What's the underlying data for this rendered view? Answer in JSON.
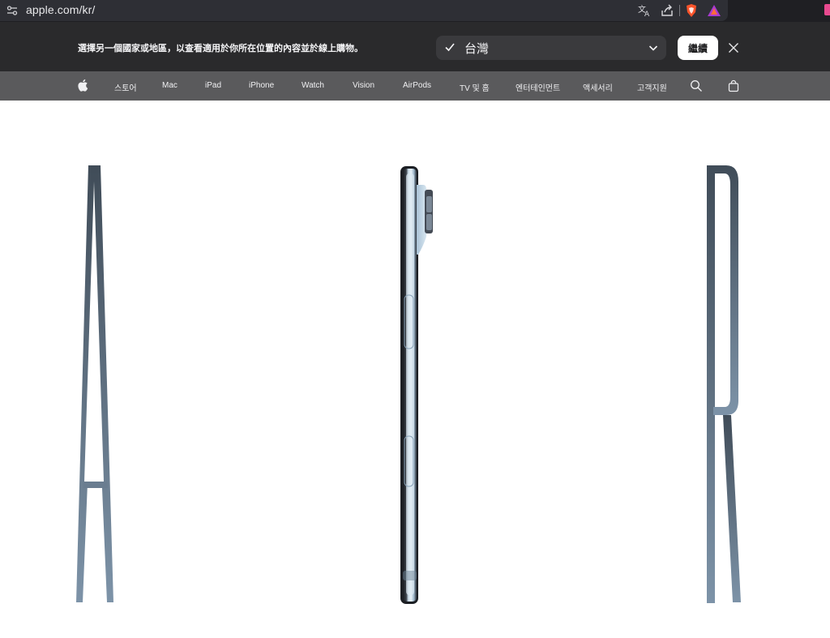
{
  "browser": {
    "url": "apple.com/kr/",
    "icons": [
      "site-info-icon",
      "translate-icon",
      "share-icon",
      "brave-shields-icon",
      "brave-rewards-icon",
      "extension-icon"
    ]
  },
  "banner": {
    "message": "選擇另一個國家或地區，以查看適用於你所在位置的內容並於線上購物。",
    "selected_country": "台灣",
    "continue_label": "繼續"
  },
  "nav": {
    "items": [
      {
        "label": "스토어"
      },
      {
        "label": "Mac"
      },
      {
        "label": "iPad"
      },
      {
        "label": "iPhone"
      },
      {
        "label": "Watch"
      },
      {
        "label": "Vision"
      },
      {
        "label": "AirPods"
      },
      {
        "label": "TV 및 홈"
      },
      {
        "label": "엔터테인먼트"
      },
      {
        "label": "액세서리"
      },
      {
        "label": "고객지원"
      }
    ]
  },
  "hero": {
    "letters": [
      "A",
      "R"
    ],
    "accent_gradient": [
      "#404c58",
      "#7d93a8"
    ],
    "device": "iphone-side-profile"
  }
}
